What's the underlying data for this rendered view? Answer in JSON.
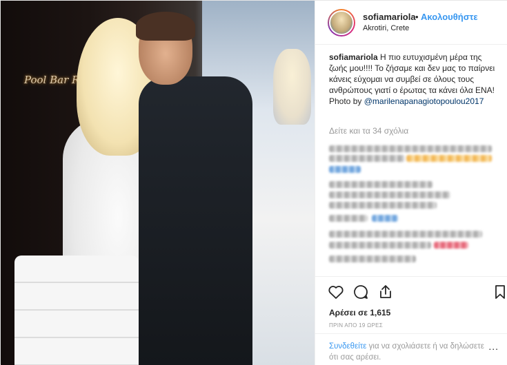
{
  "header": {
    "username": "sofiamariola",
    "separator": "•",
    "follow_label": "Ακολουθήστε",
    "location": "Akrotiri, Crete"
  },
  "photo": {
    "bar_sign": "Pool Bar R"
  },
  "caption": {
    "username": "sofiamariola",
    "text": "Η πιο ευτυχισμένη μέρα της ζωής μου!!!! Το ζήσαμε και δεν μας το παίρνει κάνεις εύχομαι να συμβεί σε όλους τους ανθρώπους γιατί ο έρωτας τα κάνει όλα ΕΝΑ!",
    "photo_by_prefix": "Photo by",
    "mention": "@marilenapanagiotopoulou2017"
  },
  "view_comments": "Δείτε και τα 34 σχόλια",
  "actions": {
    "likes": "Αρέσει σε 1,615",
    "time": "ΠΡΙΝ ΑΠΟ 19 ΩΡΕΣ"
  },
  "login": {
    "link": "Συνδεθείτε",
    "text": " για να σχολιάσετε ή να δηλώσετε ότι σας αρέσει.",
    "more": "..."
  },
  "colors": {
    "link_blue": "#3897f0",
    "text": "#262626",
    "muted": "#999999"
  },
  "icons": [
    "heart-icon",
    "comment-icon",
    "share-icon",
    "bookmark-icon"
  ]
}
